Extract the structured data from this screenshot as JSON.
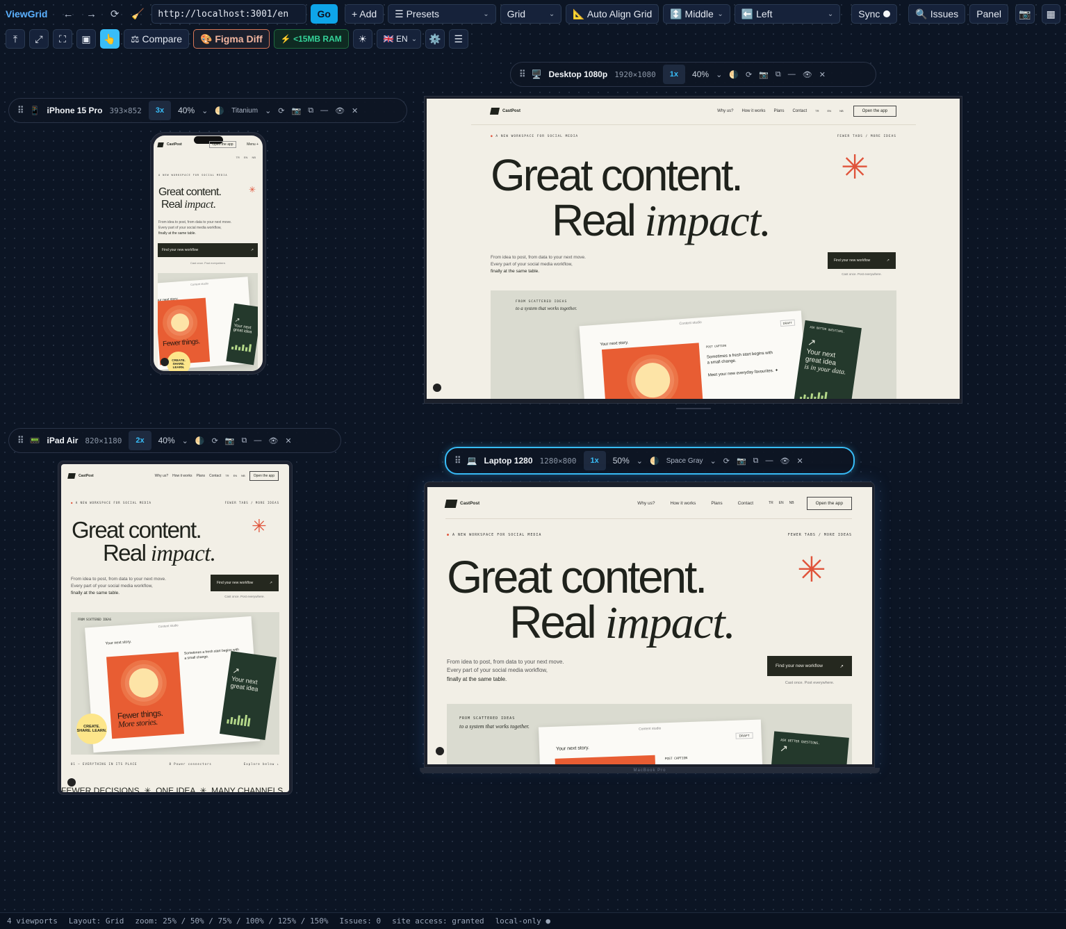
{
  "toolbar": {
    "app_name": "ViewGrid",
    "back_icon": "←",
    "forward_icon": "→",
    "reload_icon": "⟳",
    "clear_icon": "🧹",
    "url": "http://localhost:3001/en",
    "go_label": "Go",
    "add_label": "+ Add",
    "presets_label": "☰ Presets",
    "layout_label": "Grid",
    "auto_align_label": "📐 Auto Align Grid",
    "valign_label": "↕️ Middle",
    "halign_label": "⬅️ Left",
    "sync_label": "Sync",
    "issues_label": "🔍 Issues",
    "panel_label": "Panel",
    "screenshot_icon": "📷",
    "grid_icon": "▦"
  },
  "toolbar2": {
    "top_icon": "⤒",
    "fit_icon": "⤢",
    "fullscreen_icon": "⛶",
    "frame_icon": "▣",
    "hand_icon": "👆",
    "compare_label": "⚖ Compare",
    "figma_label": "🎨 Figma Diff",
    "ram_label": "⚡ <15MB RAM",
    "theme_icon": "☀",
    "lang_label": "🇬🇧 EN",
    "settings_icon": "⚙️",
    "menu_icon": "☰"
  },
  "viewports": {
    "desktop": {
      "icon": "🖥️",
      "name": "Desktop 1080p",
      "res": "1920×1080",
      "scale": "1x",
      "zoom": "40%"
    },
    "iphone": {
      "icon": "📱",
      "name": "iPhone 15 Pro",
      "res": "393×852",
      "scale": "3x",
      "zoom": "40%",
      "finish": "Titanium"
    },
    "ipad": {
      "icon": "📟",
      "name": "iPad Air",
      "res": "820×1180",
      "scale": "2x",
      "zoom": "40%"
    },
    "laptop": {
      "icon": "💻",
      "name": "Laptop 1280",
      "res": "1280×800",
      "scale": "1x",
      "zoom": "50%",
      "finish": "Space Gray"
    },
    "laptop_brand": "MacBook Pro"
  },
  "icons": {
    "grip": "⠿",
    "theme": "🌗",
    "rotate": "⟳",
    "shot": "📷",
    "copy": "⧉",
    "minimize": "—",
    "eye": "👁",
    "close": "✕",
    "chevron": "⌄",
    "arrow": "↗"
  },
  "site": {
    "brand": "CastPost",
    "nav": [
      "Why us?",
      "How it works",
      "Plans",
      "Contact"
    ],
    "langs": [
      "TR",
      "EN",
      "NB"
    ],
    "open_app": "Open the app",
    "menu": "Menu +",
    "overline": "A NEW WORKSPACE FOR SOCIAL MEDIA",
    "overline_right": "FEWER TABS / MORE IDEAS",
    "headline1": "Great content.",
    "headline2_plain": "Real",
    "headline2_em": "impact.",
    "star": "✳",
    "sub1": "From idea to post, from data to your next move.",
    "sub2": "Every part of your social media workflow,",
    "sub3": "finally at the same table.",
    "cta": "Find your new workflow",
    "cta_note": "Cast once. Post everywhere.",
    "scattered": "FROM SCATTERED IDEAS",
    "system": "to a system that works together.",
    "studio_title": "Content studio",
    "draft": "DRAFT",
    "next_story": "Your next story.",
    "post_caption": "POST CAPTION",
    "caption_text": "Sometimes a fresh start begins with a small change.",
    "meet": "Meet your new everyday favourites. ✦",
    "poster1": "Fewer things.",
    "poster2": "More stories.",
    "ask": "ASK BETTER QUESTIONS.",
    "dark_text1": "Your next great idea",
    "dark_text2": "is in your data.",
    "badge": "CREATE. SHARE. LEARN.",
    "footer_left": "01 — EVERYTHING IN ITS PLACE",
    "footer_mid": "8 Power connectors",
    "footer_right": "Explore below ↓",
    "marquee": "FEWER DECISIONS  ✳  ONE IDEA  ✳  MANY CHANNELS"
  },
  "status": {
    "viewports": "4 viewports",
    "layout": "Layout: Grid",
    "zoom": "zoom: 25% / 50% / 75% / 100% / 125% / 150%",
    "issues": "Issues: 0",
    "access": "site access: granted",
    "local": "local-only ●"
  },
  "colors": {
    "accent": "#38bdf8",
    "brand_orange": "#e0533a",
    "dark_green": "#24392c",
    "site_bg": "#f2efe6",
    "app_bg": "#0c1524"
  }
}
